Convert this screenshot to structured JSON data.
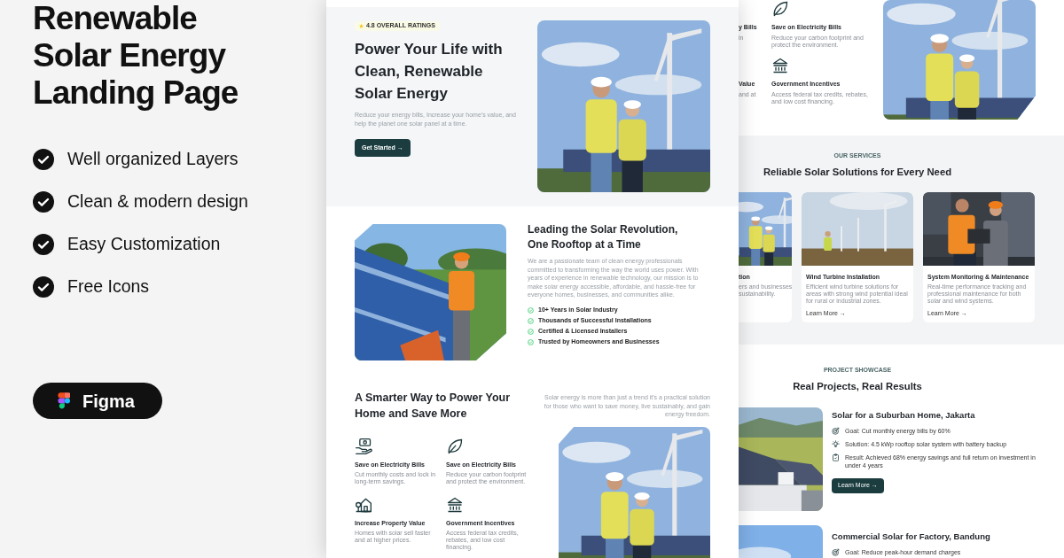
{
  "promo": {
    "title_lines": [
      "Renewable",
      "Solar Energy",
      "Landing Page"
    ],
    "features": [
      "Well organized Layers",
      "Clean & modern design",
      "Easy Customization",
      "Free Icons"
    ],
    "tool": "Figma"
  },
  "hero": {
    "rating": "4.8 OVERALL RATINGS",
    "heading": "Power Your Life with Clean, Renewable Solar Energy",
    "text": "Reduce your energy bills, Increase your home's value, and help the planet one solar panel at a time.",
    "button": "Get Started →"
  },
  "about": {
    "heading": "Leading the Solar Revolution, One Rooftop at a Time",
    "text": "We are a passionate team of clean energy professionals committed to transforming the way the world uses power. With years of experience in renewable technology, our mission is to make solar energy accessible, affordable, and hassle-free for everyone homes, businesses, and communities alike.",
    "points": [
      "10+ Years in Solar Industry",
      "Thousands of Successful Installations",
      "Certified & Licensed Installers",
      "Trusted by Homeowners and Businesses"
    ]
  },
  "benefits": {
    "heading": "A Smarter Way to Power Your Home and Save More",
    "text": "Solar energy is more than just a trend it's a practical solution for those who want to save money, live sustainably, and gain energy freedom.",
    "items": [
      {
        "kind": "savings",
        "title": "Save on Electricity Bills",
        "text": "Cut monthly costs and lock in long-term savings."
      },
      {
        "kind": "leaf",
        "title": "Save on Electricity Bills",
        "text": "Reduce your carbon footprint and protect the environment."
      },
      {
        "kind": "home",
        "title": "Increase Property Value",
        "text": "Homes with solar sell faster and at higher prices."
      },
      {
        "kind": "bank",
        "title": "Government Incentives",
        "text": "Access federal tax credits, rebates, and low cost financing."
      }
    ]
  },
  "second_page": {
    "benefits": {
      "cut_items": [
        {
          "title": "y Bills",
          "text": "in"
        },
        {
          "title": "Value",
          "text": "and at"
        }
      ],
      "items": [
        {
          "kind": "leaf",
          "title": "Save on Electricity Bills",
          "text": "Reduce your carbon footprint and protect the environment."
        },
        {
          "kind": "bank",
          "title": "Government Incentives",
          "text": "Access federal tax credits, rebates, and low cost financing."
        }
      ]
    },
    "services": {
      "eyebrow": "OUR SERVICES",
      "heading": "Reliable Solar Solutions for Every Need",
      "cut_card": {
        "title": "tion",
        "lines": [
          "ers and businesses",
          "sustainability."
        ]
      },
      "cards": [
        {
          "title": "Wind Turbine Installation",
          "text": "Efficient wind turbine solutions for areas with strong wind potential ideal for rural or industrial zones.",
          "link": "Learn More →"
        },
        {
          "title": "System Monitoring & Maintenance",
          "text": "Real-time performance tracking and professional maintenance for both solar and wind systems.",
          "link": "Learn More →"
        }
      ]
    },
    "projects": {
      "eyebrow": "PROJECT SHOWCASE",
      "heading": "Real Projects, Real Results",
      "items": [
        {
          "title": "Solar for a Suburban Home, Jakarta",
          "points": [
            {
              "kind": "goal",
              "text": "Goal: Cut monthly energy bills by 60%"
            },
            {
              "kind": "solution",
              "text": "Solution: 4.5 kWp rooftop solar system with battery backup"
            },
            {
              "kind": "result",
              "text": "Result: Achieved 68% energy savings and full return on investment in under 4 years"
            }
          ],
          "button": "Learn More →"
        },
        {
          "title": "Commercial Solar for Factory, Bandung",
          "points": [
            {
              "kind": "goal",
              "text": "Goal: Reduce peak-hour demand charges"
            }
          ]
        }
      ]
    }
  }
}
